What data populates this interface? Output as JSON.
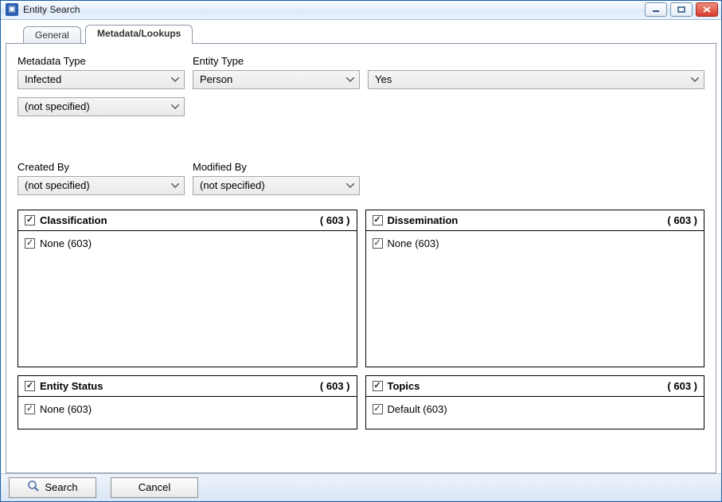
{
  "window": {
    "title": "Entity Search"
  },
  "tabs": {
    "general": "General",
    "metadata": "Metadata/Lookups"
  },
  "labels": {
    "metadata_type": "Metadata Type",
    "entity_type": "Entity Type",
    "created_by": "Created By",
    "modified_by": "Modified By"
  },
  "values": {
    "metadata_type": "Infected",
    "entity_type": "Person",
    "third_combo": "Yes",
    "second_row_combo": "(not specified)",
    "created_by": "(not specified)",
    "modified_by": "(not specified)"
  },
  "groups": {
    "classification": {
      "title": "Classification",
      "count": "( 603 )",
      "item": "None (603)"
    },
    "dissemination": {
      "title": "Dissemination",
      "count": "( 603 )",
      "item": "None (603)"
    },
    "entity_status": {
      "title": "Entity Status",
      "count": "( 603 )",
      "item": "None (603)"
    },
    "topics": {
      "title": "Topics",
      "count": "( 603 )",
      "item": "Default (603)"
    }
  },
  "buttons": {
    "search": "Search",
    "cancel": "Cancel"
  }
}
